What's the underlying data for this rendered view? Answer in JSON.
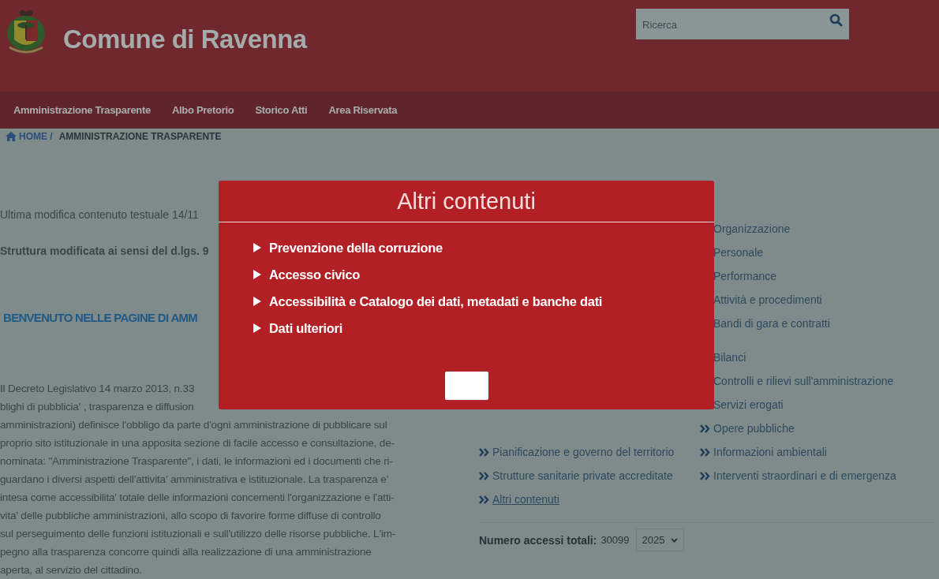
{
  "header": {
    "title": "Comune di Ravenna",
    "search": {
      "placeholder": "Ricerca"
    }
  },
  "nav": [
    {
      "label": "Amministrazione Trasparente"
    },
    {
      "label": "Albo Pretorio"
    },
    {
      "label": "Storico Atti"
    },
    {
      "label": "Area Riservata"
    }
  ],
  "breadcrumb": {
    "home": "HOME /",
    "current": "AMMINISTRAZIONE TRASPARENTE"
  },
  "content": {
    "last_modified": "Ultima modifica contenuto testuale 14/11",
    "structure_note": "Struttura modificata ai sensi del d.lgs. 9",
    "heading": "BENVENUTO NELLE PAGINE DI AMM",
    "paragraph": [
      "Il Decreto Legislativo 14 marzo 2013, n.33",
      "blighi di pubblicia' , trasparenza e diffusion",
      "amministrazioni) definisce l'obbligo da parte d'ogni amministrazione di pubblicare sul",
      "proprio sito istituzionale in una apposita sezione di facile accesso e consultazione, de-",
      "nominata: \"Amministrazione Trasparente\", i dati, le informazioni ed i documenti che ri-",
      "guardano i diversi aspetti dell'attivita' amministrativa e istituzionale. La trasparenza e'",
      "intesa come accessibilita' totale delle informazioni concernenti l'organizzazione e l'atti-",
      "vita' delle pubbliche amministrazioni, allo scopo di favorire forme diffuse di controllo",
      "sul perseguimento delle funzioni istituzionali e sull'utilizzo delle risorse pubbliche. L'im-",
      "pegno alla trasparenza concorre quindi alla realizzazione di una amministrazione",
      "aperta, al servizio del cittadino."
    ]
  },
  "sections": [
    [
      {
        "right": {
          "text": "Organizzazione"
        }
      },
      {
        "right": {
          "text": "Personale"
        }
      },
      {
        "right": {
          "text": "Performance"
        }
      },
      {
        "right": {
          "text": "Attività e procedimenti"
        }
      },
      {
        "right": {
          "text": "Bandi di gara e contratti"
        }
      }
    ],
    [
      {
        "right": {
          "text": "Bilanci"
        }
      },
      {
        "right": {
          "text": "Controlli e rilievi sull'amministrazione"
        }
      },
      {
        "right": {
          "text": "Servizi erogati"
        }
      },
      {
        "right": {
          "text": "Opere pubbliche"
        }
      },
      {
        "left": {
          "text": "Pianificazione e governo del territorio"
        },
        "right": {
          "text": "Informazioni ambientali"
        }
      },
      {
        "left": {
          "text": "Strutture sanitarie private accreditate"
        },
        "right": {
          "text": "Interventi straordinari e di emergenza"
        }
      },
      {
        "left": {
          "text": "Altri contenuti",
          "underlined": true
        }
      }
    ]
  ],
  "access": {
    "label": "Numero accessi totali:",
    "count": "30099",
    "year": "2025"
  },
  "modal": {
    "title": "Altri contenuti",
    "items": [
      "Prevenzione della corruzione",
      "Accesso civico",
      "Accessibilità e Catalogo dei dati, metadati e banche dati",
      "Dati ulteriori"
    ]
  }
}
